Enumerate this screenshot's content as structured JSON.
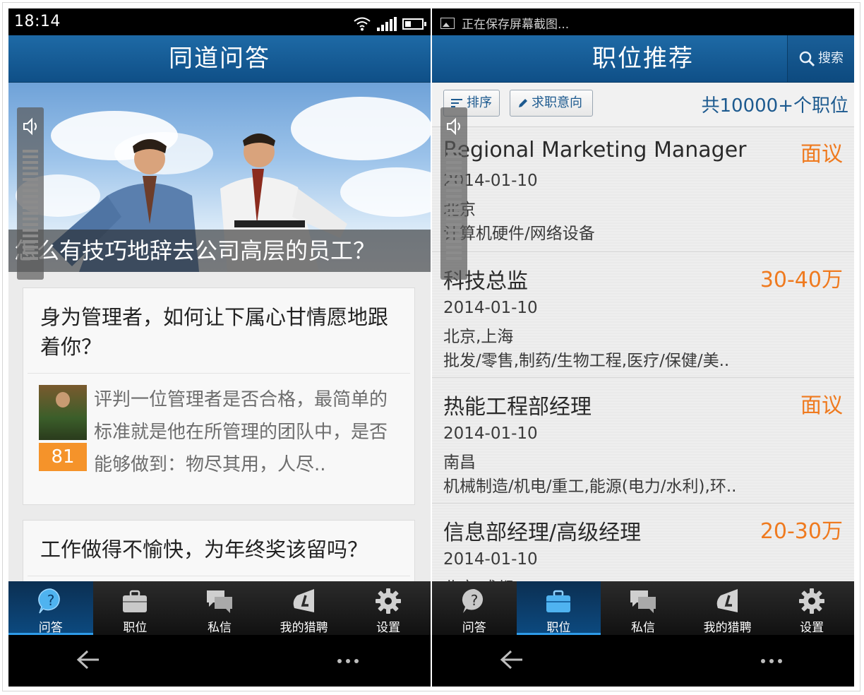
{
  "left": {
    "status": {
      "time": "18:14"
    },
    "title": "同道问答",
    "hero": {
      "caption": "怎么有技巧地辞去公司高层的员工？"
    },
    "cards": [
      {
        "title": "身为管理者，如何让下属心甘情愿地跟着你？",
        "excerpt": "评判一位管理者是否合格，最简单的标准就是他在所管理的团队中，是否能够做到：物尽其用，人尽..",
        "score": "81"
      },
      {
        "title": "工作做得不愉快，为年终奖该留吗？"
      }
    ]
  },
  "right": {
    "status": {
      "notification": "正在保存屏幕截图..."
    },
    "title": "职位推荐",
    "search_label": "搜索",
    "filters": {
      "sort_label": "排序",
      "intent_label": "求职意向"
    },
    "job_count": "共10000+个职位",
    "jobs": [
      {
        "title": "Regional Marketing Manager",
        "salary": "面议",
        "date": "2014-01-10",
        "location": "北京",
        "industry": "计算机硬件/网络设备"
      },
      {
        "title": "科技总监",
        "salary": "30-40万",
        "date": "2014-01-10",
        "location": "北京,上海",
        "industry": "批发/零售,制药/生物工程,医疗/保健/美.."
      },
      {
        "title": "热能工程部经理",
        "salary": "面议",
        "date": "2014-01-10",
        "location": "南昌",
        "industry": "机械制造/机电/重工,能源(电力/水利),环.."
      },
      {
        "title": "信息部经理/高级经理",
        "salary": "20-30万",
        "date": "2014-01-10",
        "location": "北京,成都",
        "industry": ""
      }
    ]
  },
  "tabs": [
    {
      "label": "问答",
      "icon": "question-icon"
    },
    {
      "label": "职位",
      "icon": "briefcase-icon"
    },
    {
      "label": "私信",
      "icon": "chat-icon"
    },
    {
      "label": "我的猎聘",
      "icon": "profile-icon"
    },
    {
      "label": "设置",
      "icon": "gear-icon"
    }
  ],
  "colors": {
    "title_bar": "#1e6aa6",
    "accent_orange": "#ef7a1f",
    "link_blue": "#1d5a8f",
    "tab_active": "#0c4a80"
  }
}
